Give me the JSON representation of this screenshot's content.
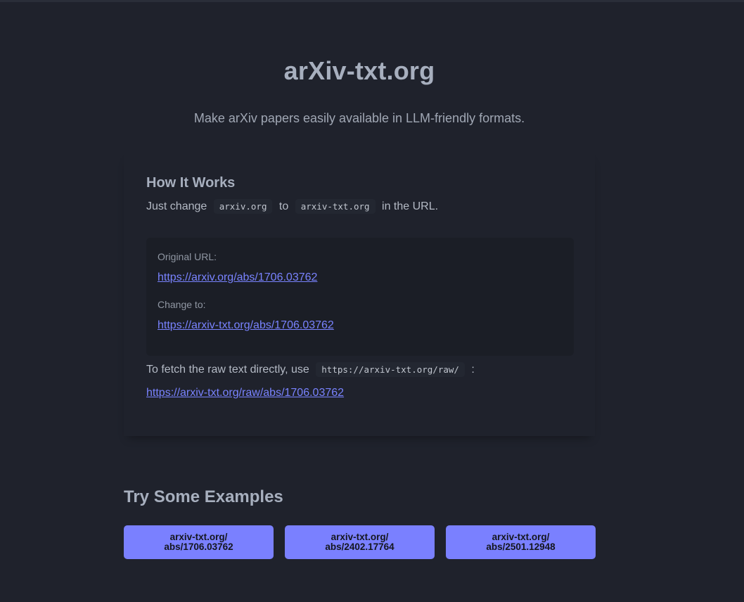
{
  "header": {
    "title": "arXiv-txt.org",
    "tagline": "Make arXiv papers easily available in LLM-friendly formats."
  },
  "how_it_works": {
    "title": "How It Works",
    "instruction_prefix": "Just change",
    "code_from": "arxiv.org",
    "instruction_middle": "to",
    "code_to": "arxiv-txt.org",
    "instruction_suffix": "in the URL.",
    "original_label": "Original URL:",
    "original_url": "https://arxiv.org/abs/1706.03762",
    "change_label": "Change to:",
    "change_url": "https://arxiv-txt.org/abs/1706.03762",
    "raw_prefix": "To fetch the raw text directly, use",
    "raw_code": "https://arxiv-txt.org/raw/",
    "raw_suffix": ":",
    "raw_url": "https://arxiv-txt.org/raw/abs/1706.03762"
  },
  "examples": {
    "title": "Try Some Examples",
    "buttons": [
      {
        "line1": "arxiv-txt.org/",
        "line2": "abs/1706.03762"
      },
      {
        "line1": "arxiv-txt.org/",
        "line2": "abs/2402.17764"
      },
      {
        "line1": "arxiv-txt.org/",
        "line2": "abs/2501.12948"
      }
    ]
  },
  "colors": {
    "background": "#1f222c",
    "link": "#7983ff",
    "button": "#7a80ff"
  }
}
